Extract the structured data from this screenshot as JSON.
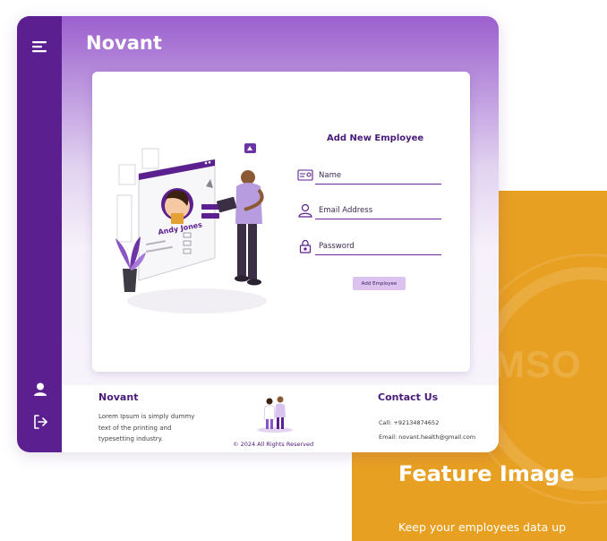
{
  "feature": {
    "title": "Feature Image",
    "text": "Keep your employees data up",
    "watermark": "MSO"
  },
  "app": {
    "brand": "Novant",
    "sidebar": {
      "menu_icon": "menu-icon",
      "user_icon": "user-icon",
      "logout_icon": "logout-icon"
    },
    "form": {
      "title": "Add New Employee",
      "name_placeholder": "Name",
      "email_placeholder": "Email Address",
      "password_placeholder": "Password",
      "submit_label": "Add Employee"
    },
    "illustration": {
      "profile_name": "Andy Jones"
    },
    "footer": {
      "brand": "Novant",
      "description": "Lorem Ipsum is simply dummy text of the printing and typesetting industry.",
      "copyright": "© 2024 All Rights Reserved",
      "contact_title": "Contact Us",
      "phone": "Call: +92134874652",
      "email": "Email: novant.health@gmail.com"
    }
  },
  "colors": {
    "sidebar": "#5b1f8f",
    "accent": "#4a1a78",
    "feature_bg": "#e8a022",
    "button_bg": "#dcc2ef"
  }
}
